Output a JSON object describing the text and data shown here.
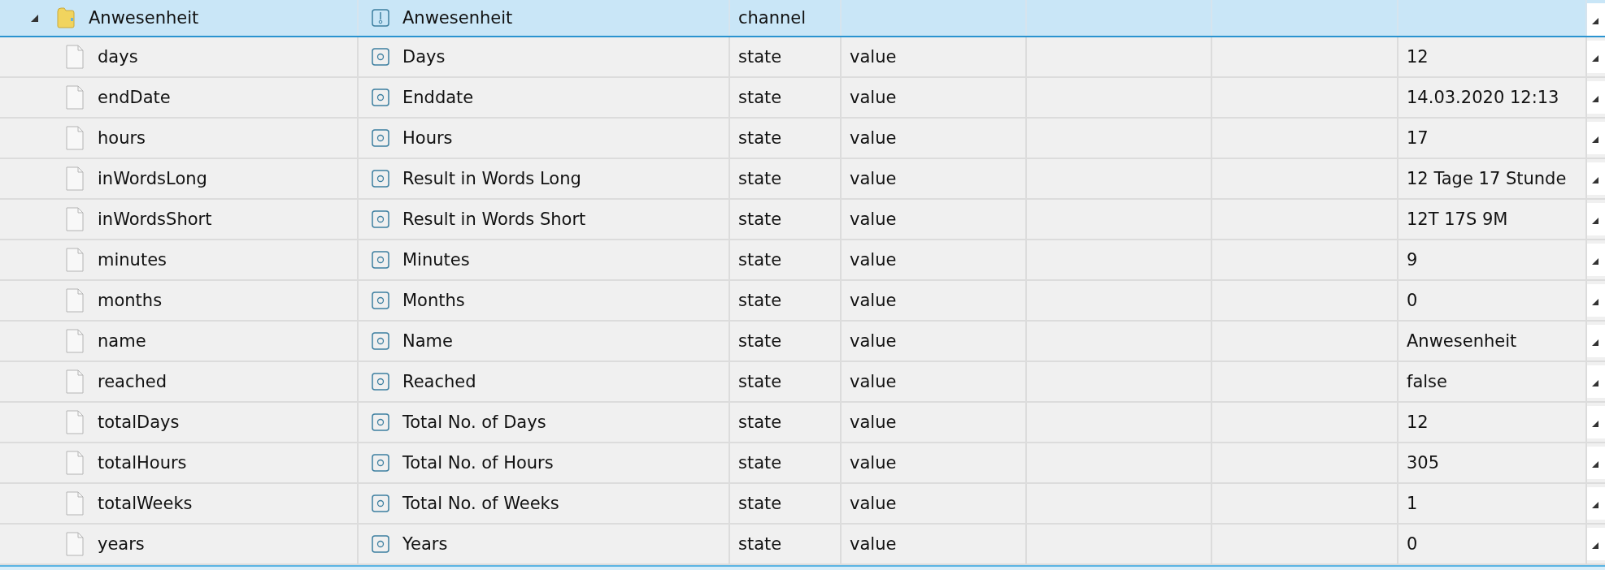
{
  "channel": {
    "id": "Anwesenheit",
    "expanded": true,
    "name": "Anwesenheit",
    "type": "channel"
  },
  "rows": [
    {
      "id": "days",
      "name": "Days",
      "type": "state",
      "role": "value",
      "value": "12"
    },
    {
      "id": "endDate",
      "name": "Enddate",
      "type": "state",
      "role": "value",
      "value": "14.03.2020 12:13"
    },
    {
      "id": "hours",
      "name": "Hours",
      "type": "state",
      "role": "value",
      "value": "17"
    },
    {
      "id": "inWordsLong",
      "name": "Result in Words Long",
      "type": "state",
      "role": "value",
      "value": "12 Tage 17 Stunde"
    },
    {
      "id": "inWordsShort",
      "name": "Result in Words Short",
      "type": "state",
      "role": "value",
      "value": "12T 17S 9M"
    },
    {
      "id": "minutes",
      "name": "Minutes",
      "type": "state",
      "role": "value",
      "value": "9"
    },
    {
      "id": "months",
      "name": "Months",
      "type": "state",
      "role": "value",
      "value": "0"
    },
    {
      "id": "name",
      "name": "Name",
      "type": "state",
      "role": "value",
      "value": "Anwesenheit"
    },
    {
      "id": "reached",
      "name": "Reached",
      "type": "state",
      "role": "value",
      "value": "false"
    },
    {
      "id": "totalDays",
      "name": "Total No. of Days",
      "type": "state",
      "role": "value",
      "value": "12"
    },
    {
      "id": "totalHours",
      "name": "Total No. of Hours",
      "type": "state",
      "role": "value",
      "value": "305"
    },
    {
      "id": "totalWeeks",
      "name": "Total No. of Weeks",
      "type": "state",
      "role": "value",
      "value": "1"
    },
    {
      "id": "years",
      "name": "Years",
      "type": "state",
      "role": "value",
      "value": "0"
    }
  ]
}
